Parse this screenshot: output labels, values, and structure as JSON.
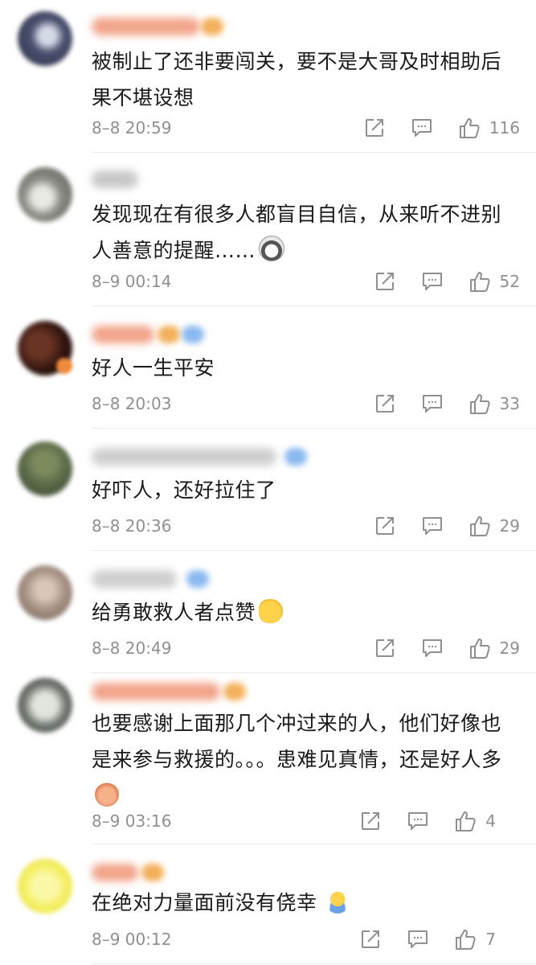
{
  "comments": [
    {
      "text": "被制止了还非要闯关，要不是大哥及时相助后果不堪设想",
      "time": "8–8 20:59",
      "likes": "116",
      "avatar_color": "#4a5070",
      "name_color": "#f2a48a",
      "badge_color": "#f3b05a"
    },
    {
      "text": "发现现在有很多人都盲目自信，从来听不进别人善意的提醒……",
      "time": "8–9 00:14",
      "likes": "52",
      "avatar_color": "#8a8a84",
      "name_color": "#c8c8c8",
      "emoji": "husky-face-emoji"
    },
    {
      "text": "好人一生平安",
      "time": "8–8 20:03",
      "likes": "33",
      "avatar_color": "#3a1c14",
      "name_color": "#f2a48a",
      "badge_color": "#f3b05a"
    },
    {
      "text": "好吓人，还好拉住了",
      "time": "8–8 20:36",
      "likes": "29",
      "avatar_color": "#5b6a48",
      "name_color": "#cfcfcf",
      "badge_color": "#8ab9f0"
    },
    {
      "text": "给勇敢救人者点赞",
      "time": "8–8 20:49",
      "likes": "29",
      "avatar_color": "#a89386",
      "name_color": "#cfcfcf",
      "badge_color": "#8ab9f0",
      "emoji": "thumbs-up-emoji"
    },
    {
      "text": "也要感谢上面那几个冲过来的人，他们好像也是来参与救援的。。。患难见真情，还是好人多",
      "time": "8–9 03:16",
      "likes": "4",
      "avatar_color": "#6f746e",
      "name_color": "#f2a48a",
      "badge_color": "#f3b05a",
      "emoji": "praying-hands-emoji"
    },
    {
      "text": "在绝对力量面前没有侥幸",
      "time": "8–9 00:12",
      "likes": "7",
      "avatar_color": "#f4ef62",
      "name_color": "#f2a48a",
      "badge_color": "#f3b05a",
      "emoji": "shrug-emoji"
    }
  ],
  "icons": {
    "share": "share-icon",
    "reply": "comment-icon",
    "like": "thumbs-up-icon"
  },
  "colors": {
    "text": "#1a1a1a",
    "meta": "#8f8f8f",
    "divider": "#ececec"
  }
}
